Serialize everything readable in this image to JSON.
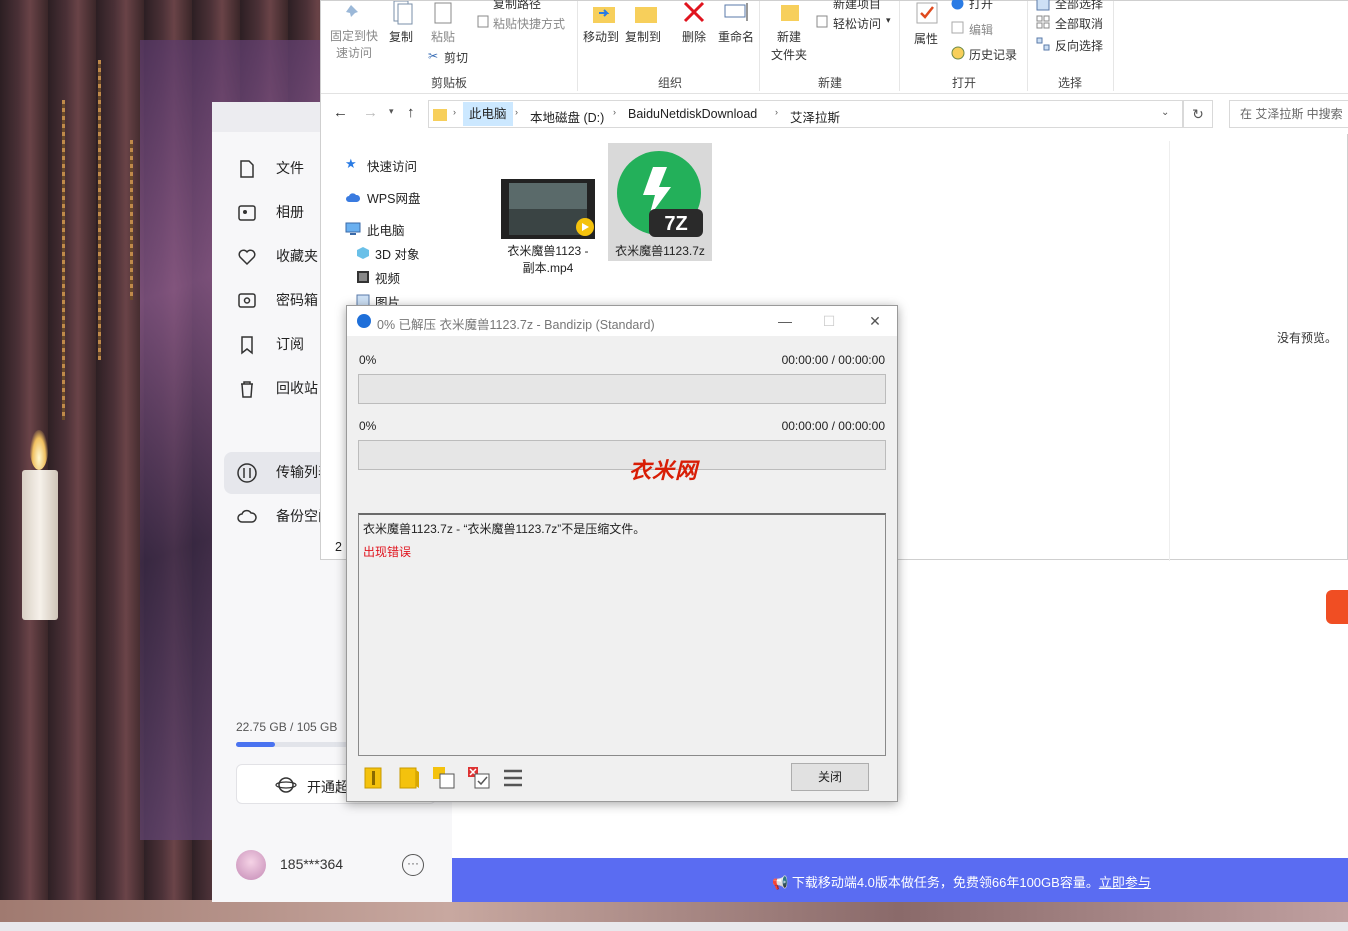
{
  "ribbon": {
    "pin_label": "固定到快\n速访问",
    "copy_label": "复制",
    "paste_label": "粘贴",
    "copy_path_label": "复制路径",
    "paste_shortcut_label": "粘贴快捷方式",
    "cut_label": "剪切",
    "clipboard_group": "剪贴板",
    "move_to_label": "移动到",
    "copy_to_label": "复制到",
    "delete_label": "删除",
    "rename_label": "重命名",
    "organize_group": "组织",
    "new_folder_label": "新建\n文件夹",
    "new_item_label": "新建项目",
    "easy_access_label": "轻松访问",
    "new_group": "新建",
    "properties_label": "属性",
    "open_label": "打开",
    "edit_label": "编辑",
    "history_label": "历史记录",
    "open_group": "打开",
    "select_all_label": "全部选择",
    "select_none_label": "全部取消",
    "invert_label": "反向选择",
    "select_group": "选择"
  },
  "address": {
    "crumbs": [
      "此电脑",
      "本地磁盘 (D:)",
      "BaiduNetdiskDownload",
      "艾泽拉斯"
    ],
    "search_placeholder": "在 艾泽拉斯 中搜索"
  },
  "navtree": [
    "快速访问",
    "WPS网盘",
    "此电脑",
    "3D 对象",
    "视频",
    "图片"
  ],
  "files": [
    {
      "name": "衣米魔兽1123 - 副本.mp4",
      "line1": "衣米魔兽1123 -",
      "line2": "副本.mp4"
    },
    {
      "name": "衣米魔兽1123.7z",
      "line1": "衣米魔兽1123.7z",
      "line2": ""
    }
  ],
  "preview_text": "没有预览。",
  "status_count": "2",
  "netdisk": {
    "items": [
      "文件",
      "相册",
      "收藏夹",
      "密码箱",
      "订阅",
      "回收站",
      "传输列表",
      "备份空间"
    ],
    "storage_text": "22.75 GB / 105 GB",
    "storage_used_fraction": 0.217,
    "vip_label": "开通超级会员",
    "username": "185***364",
    "banner_text": "下载移动端4.0版本做任务，免费领66年100GB容量。",
    "banner_link": "立即参与"
  },
  "dialog": {
    "title": "0% 已解压 衣米魔兽1123.7z - Bandizip (Standard)",
    "progress1_pct": "0%",
    "progress1_time": "00:00:00 / 00:00:00",
    "progress1_value": 0,
    "progress2_pct": "0%",
    "progress2_time": "00:00:00 / 00:00:00",
    "progress2_value": 0,
    "watermark": "衣米网",
    "log_line": "衣米魔兽1123.7z - “衣米魔兽1123.7z”不是压缩文件。",
    "log_error": "出现错误",
    "close_label": "关闭"
  },
  "colors": {
    "accent_blue": "#5a6cf2",
    "error_red": "#e0141e",
    "selection": "#cce8ff"
  }
}
